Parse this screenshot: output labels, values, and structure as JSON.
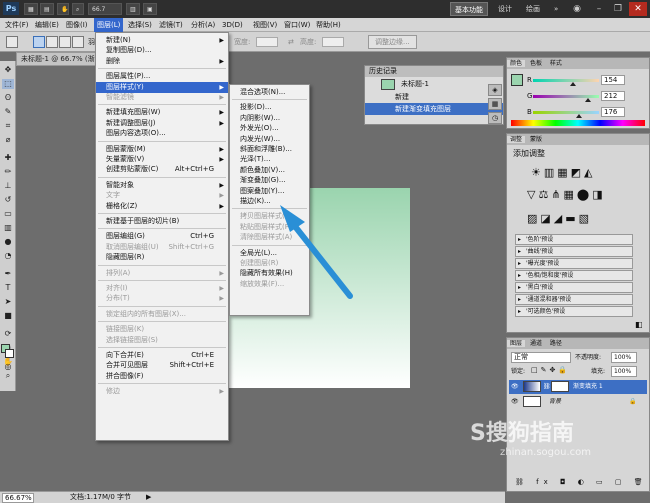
{
  "titlebar": {
    "logo": "Ps",
    "zoom_select": "66.7",
    "workspaces": [
      "基本功能",
      "设计",
      "绘画"
    ],
    "more": "»"
  },
  "menubar": {
    "items": [
      "文件(F)",
      "编辑(E)",
      "图像(I)",
      "图层(L)",
      "选择(S)",
      "滤镜(T)",
      "分析(A)",
      "3D(D)",
      "视图(V)",
      "窗口(W)",
      "帮助(H)"
    ],
    "active_index": 3
  },
  "options_bar": {
    "feather_label": "羽",
    "width_label": "宽度:",
    "height_label": "高度:",
    "refine_edge": "调整边缘..."
  },
  "document": {
    "tab_title": "未标题-1 @ 66.7% (渐"
  },
  "status": {
    "zoom": "66.67%",
    "doc_info": "文档:1.17M/0 字节"
  },
  "layer_menu": {
    "items": [
      {
        "label": "新建(N)",
        "arrow": true
      },
      {
        "label": "复制图层(D)..."
      },
      {
        "label": "删除",
        "arrow": true
      },
      {
        "sep": true
      },
      {
        "label": "图层属性(P)..."
      },
      {
        "label": "图层样式(Y)",
        "arrow": true,
        "highlight": true
      },
      {
        "label": "智能滤镜",
        "arrow": true,
        "disabled": true
      },
      {
        "sep": true
      },
      {
        "label": "新建填充图层(W)",
        "arrow": true
      },
      {
        "label": "新建调整图层(J)",
        "arrow": true
      },
      {
        "label": "图层内容选项(O)..."
      },
      {
        "sep": true
      },
      {
        "label": "图层蒙版(M)",
        "arrow": true
      },
      {
        "label": "矢量蒙版(V)",
        "arrow": true
      },
      {
        "label": "创建剪贴蒙版(C)",
        "shortcut": "Alt+Ctrl+G"
      },
      {
        "sep": true
      },
      {
        "label": "智能对象",
        "arrow": true
      },
      {
        "label": "文字",
        "arrow": true,
        "disabled": true
      },
      {
        "label": "栅格化(Z)",
        "arrow": true
      },
      {
        "sep": true
      },
      {
        "label": "新建基于图层的切片(B)"
      },
      {
        "sep": true
      },
      {
        "label": "图层编组(G)",
        "shortcut": "Ctrl+G"
      },
      {
        "label": "取消图层编组(U)",
        "shortcut": "Shift+Ctrl+G",
        "disabled": true
      },
      {
        "label": "隐藏图层(R)"
      },
      {
        "sep": true
      },
      {
        "label": "排列(A)",
        "arrow": true,
        "disabled": true
      },
      {
        "sep": true
      },
      {
        "label": "对齐(I)",
        "arrow": true,
        "disabled": true
      },
      {
        "label": "分布(T)",
        "arrow": true,
        "disabled": true
      },
      {
        "sep": true
      },
      {
        "label": "锁定组内的所有图层(X)...",
        "disabled": true
      },
      {
        "sep": true
      },
      {
        "label": "链接图层(K)",
        "disabled": true
      },
      {
        "label": "选择链接图层(S)",
        "disabled": true
      },
      {
        "sep": true
      },
      {
        "label": "向下合并(E)",
        "shortcut": "Ctrl+E"
      },
      {
        "label": "合并可见图层",
        "shortcut": "Shift+Ctrl+E"
      },
      {
        "label": "拼合图像(F)"
      },
      {
        "sep": true
      },
      {
        "label": "修边",
        "arrow": true,
        "disabled": true
      }
    ]
  },
  "style_submenu": {
    "items": [
      {
        "label": "混合选项(N)..."
      },
      {
        "sep": true
      },
      {
        "label": "投影(D)..."
      },
      {
        "label": "内阴影(W)..."
      },
      {
        "label": "外发光(O)..."
      },
      {
        "label": "内发光(W)..."
      },
      {
        "label": "斜面和浮雕(B)..."
      },
      {
        "label": "光泽(T)..."
      },
      {
        "label": "颜色叠加(V)..."
      },
      {
        "label": "渐变叠加(G)..."
      },
      {
        "label": "图案叠加(Y)..."
      },
      {
        "label": "描边(K)..."
      },
      {
        "sep": true
      },
      {
        "label": "拷贝图层样式(C)",
        "disabled": true
      },
      {
        "label": "粘贴图层样式(P)",
        "disabled": true
      },
      {
        "label": "清除图层样式(A)",
        "disabled": true
      },
      {
        "sep": true
      },
      {
        "label": "全局光(L)..."
      },
      {
        "label": "创建图层(R)",
        "disabled": true
      },
      {
        "label": "隐藏所有效果(H)"
      },
      {
        "label": "缩放效果(F)...",
        "disabled": true
      }
    ]
  },
  "history": {
    "title": "历史记录",
    "snapshot": "未标题-1",
    "rows": [
      "新建",
      "新建渐变填充图层"
    ]
  },
  "color_panel": {
    "tabs": [
      "颜色",
      "色板",
      "样式"
    ],
    "channels": [
      {
        "label": "R",
        "value": "154",
        "level": 0.6
      },
      {
        "label": "G",
        "value": "212",
        "level": 0.83
      },
      {
        "label": "B",
        "value": "176",
        "level": 0.69
      }
    ]
  },
  "adjust_panel": {
    "tabs": [
      "调整",
      "蒙版"
    ],
    "title": "添加调整",
    "presets": [
      "'色阶'预设",
      "'曲线'预设",
      "'曝光度'预设",
      "'色相/饱和度'预设",
      "'黑白'预设",
      "'通道混和器'预设",
      "'可选颜色'预设"
    ]
  },
  "layers_panel": {
    "tabs": [
      "图层",
      "通道",
      "路径"
    ],
    "blend_mode": "正常",
    "opacity_label": "不透明度:",
    "opacity": "100%",
    "lock_label": "锁定:",
    "fill_label": "填充:",
    "fill": "100%",
    "layers": [
      {
        "name": "渐变填充 1",
        "selected": true
      },
      {
        "name": "背景",
        "selected": false
      }
    ]
  },
  "watermark": {
    "logo": "S搜狗指南",
    "url": "zhinan.sogou.com"
  },
  "colors": {
    "accent": "#3366cc",
    "canvas_top": "#9ad4ae",
    "arrow": "#2a8fd6"
  }
}
